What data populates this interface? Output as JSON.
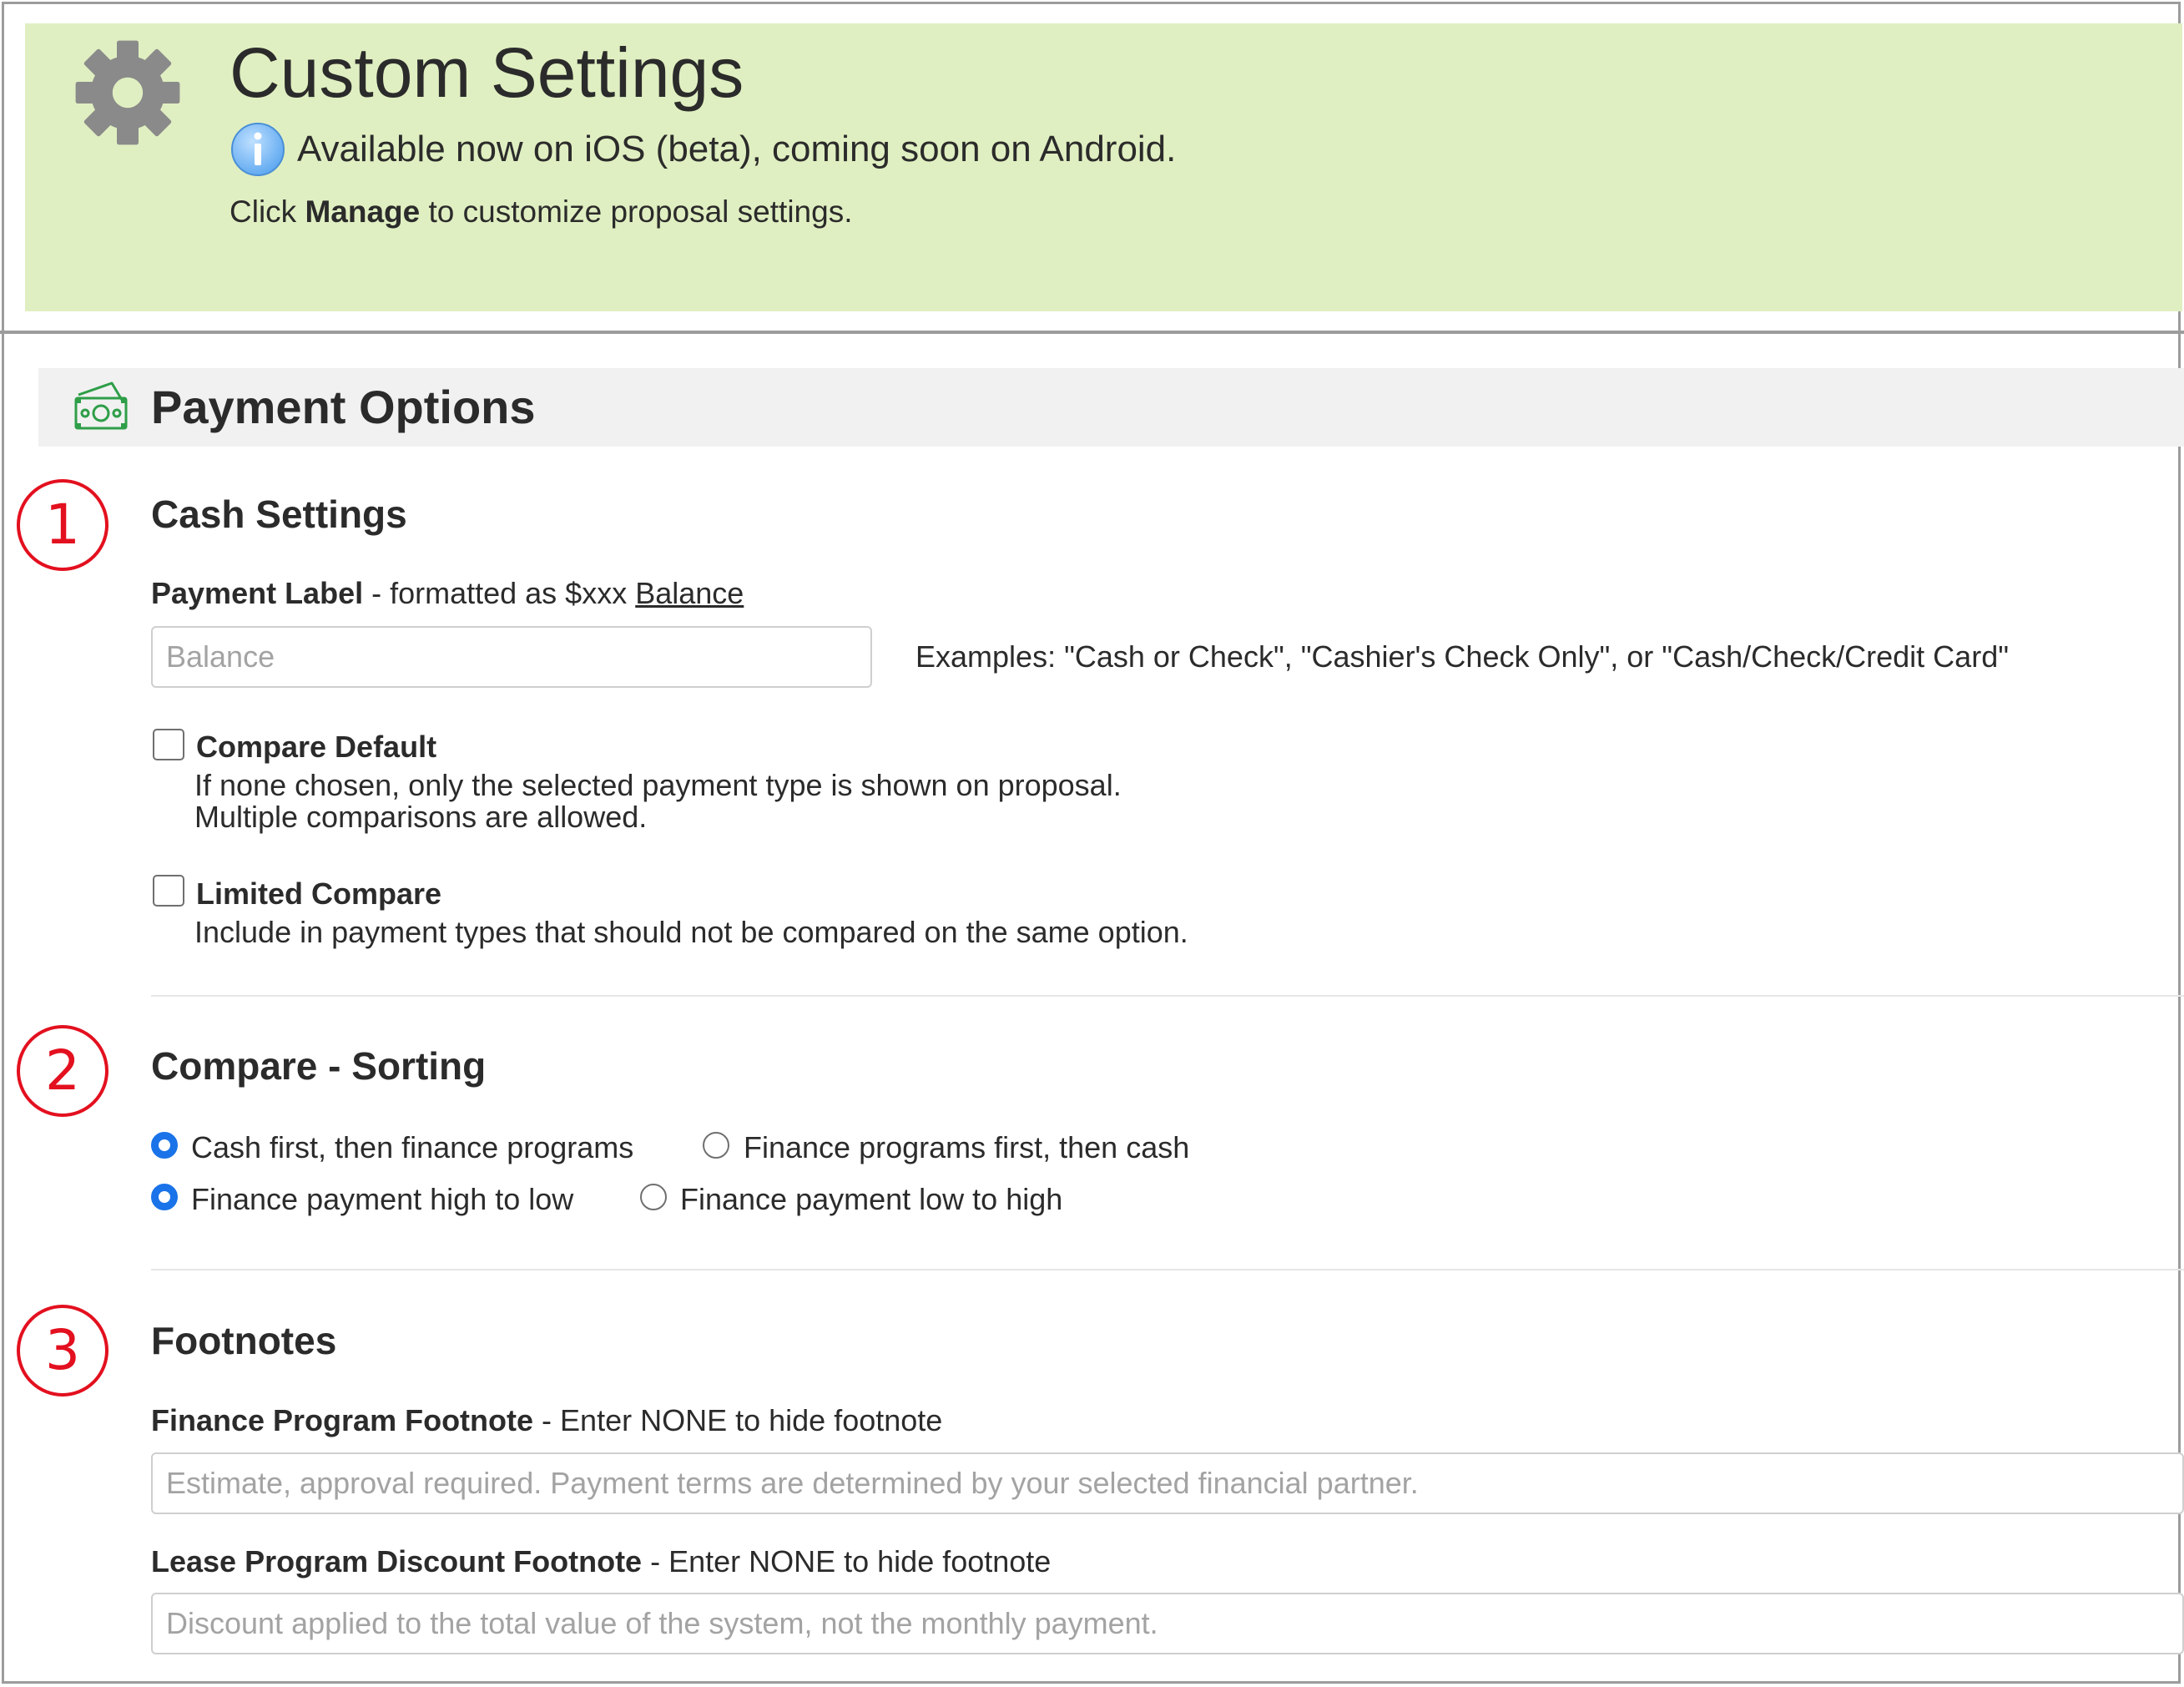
{
  "header": {
    "title": "Custom Settings",
    "availability": "Available now on iOS (beta), coming soon on Android.",
    "instructions_prefix": "Click ",
    "instructions_bold": "Manage",
    "instructions_suffix": " to customize proposal settings.",
    "background_color": "#e0efc1",
    "icons": {
      "settings": "gear-icon",
      "info": "info-icon"
    }
  },
  "section": {
    "title": "Payment Options",
    "icon": "money-icon",
    "icon_color": "#2e9e48"
  },
  "markers": [
    "1",
    "2",
    "3"
  ],
  "marker_color": "#e3101f",
  "cash_settings": {
    "title": "Cash Settings",
    "payment_label": {
      "label_bold": "Payment Label",
      "label_rest": " - formatted as $xxx ",
      "label_link": "Balance",
      "placeholder": "Balance",
      "value": "",
      "examples": "Examples: \"Cash or Check\", \"Cashier's Check Only\", or \"Cash/Check/Credit Card\""
    },
    "compare_default": {
      "label": "Compare Default",
      "checked": false,
      "desc_line1": "If none chosen, only the selected payment type is shown on proposal.",
      "desc_line2": "Multiple comparisons are allowed."
    },
    "limited_compare": {
      "label": "Limited Compare",
      "checked": false,
      "desc": "Include in payment types that should not be compared on the same option."
    }
  },
  "compare_sorting": {
    "title": "Compare - Sorting",
    "group1": {
      "options": [
        "Cash first, then finance programs",
        "Finance programs first, then cash"
      ],
      "selected": "Cash first, then finance programs"
    },
    "group2": {
      "options": [
        "Finance payment high to low",
        "Finance payment low to high"
      ],
      "selected": "Finance payment high to low"
    },
    "accent_color": "#1a73e8"
  },
  "footnotes": {
    "title": "Footnotes",
    "finance": {
      "label_bold": "Finance Program Footnote",
      "label_rest": " - Enter NONE to hide footnote",
      "placeholder": "Estimate, approval required. Payment terms are determined by your selected financial partner.",
      "value": ""
    },
    "lease": {
      "label_bold": "Lease Program Discount Footnote",
      "label_rest": " - Enter NONE to hide footnote",
      "placeholder": "Discount applied to the total value of the system, not the monthly payment.",
      "value": ""
    }
  }
}
